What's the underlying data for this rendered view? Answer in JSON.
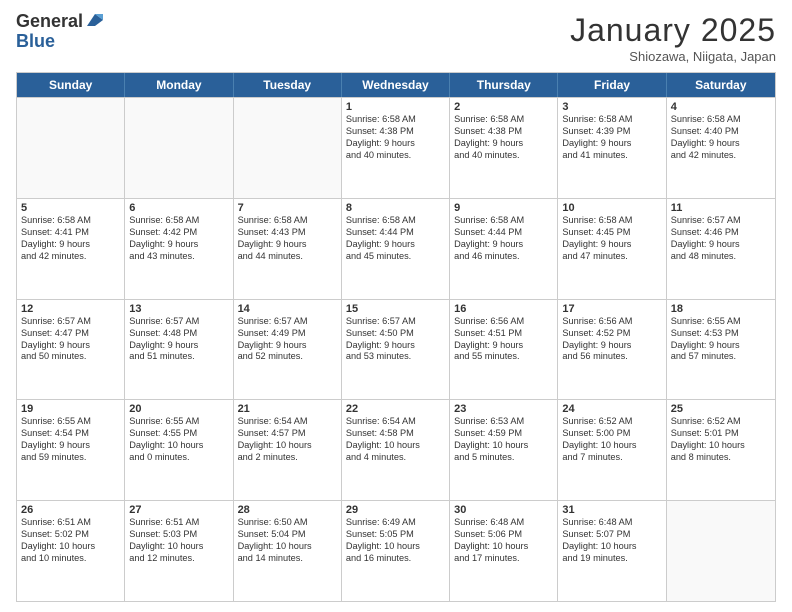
{
  "logo": {
    "general": "General",
    "blue": "Blue"
  },
  "title": "January 2025",
  "subtitle": "Shiozawa, Niigata, Japan",
  "days": [
    "Sunday",
    "Monday",
    "Tuesday",
    "Wednesday",
    "Thursday",
    "Friday",
    "Saturday"
  ],
  "rows": [
    [
      {
        "day": "",
        "lines": []
      },
      {
        "day": "",
        "lines": []
      },
      {
        "day": "",
        "lines": []
      },
      {
        "day": "1",
        "lines": [
          "Sunrise: 6:58 AM",
          "Sunset: 4:38 PM",
          "Daylight: 9 hours",
          "and 40 minutes."
        ]
      },
      {
        "day": "2",
        "lines": [
          "Sunrise: 6:58 AM",
          "Sunset: 4:38 PM",
          "Daylight: 9 hours",
          "and 40 minutes."
        ]
      },
      {
        "day": "3",
        "lines": [
          "Sunrise: 6:58 AM",
          "Sunset: 4:39 PM",
          "Daylight: 9 hours",
          "and 41 minutes."
        ]
      },
      {
        "day": "4",
        "lines": [
          "Sunrise: 6:58 AM",
          "Sunset: 4:40 PM",
          "Daylight: 9 hours",
          "and 42 minutes."
        ]
      }
    ],
    [
      {
        "day": "5",
        "lines": [
          "Sunrise: 6:58 AM",
          "Sunset: 4:41 PM",
          "Daylight: 9 hours",
          "and 42 minutes."
        ]
      },
      {
        "day": "6",
        "lines": [
          "Sunrise: 6:58 AM",
          "Sunset: 4:42 PM",
          "Daylight: 9 hours",
          "and 43 minutes."
        ]
      },
      {
        "day": "7",
        "lines": [
          "Sunrise: 6:58 AM",
          "Sunset: 4:43 PM",
          "Daylight: 9 hours",
          "and 44 minutes."
        ]
      },
      {
        "day": "8",
        "lines": [
          "Sunrise: 6:58 AM",
          "Sunset: 4:44 PM",
          "Daylight: 9 hours",
          "and 45 minutes."
        ]
      },
      {
        "day": "9",
        "lines": [
          "Sunrise: 6:58 AM",
          "Sunset: 4:44 PM",
          "Daylight: 9 hours",
          "and 46 minutes."
        ]
      },
      {
        "day": "10",
        "lines": [
          "Sunrise: 6:58 AM",
          "Sunset: 4:45 PM",
          "Daylight: 9 hours",
          "and 47 minutes."
        ]
      },
      {
        "day": "11",
        "lines": [
          "Sunrise: 6:57 AM",
          "Sunset: 4:46 PM",
          "Daylight: 9 hours",
          "and 48 minutes."
        ]
      }
    ],
    [
      {
        "day": "12",
        "lines": [
          "Sunrise: 6:57 AM",
          "Sunset: 4:47 PM",
          "Daylight: 9 hours",
          "and 50 minutes."
        ]
      },
      {
        "day": "13",
        "lines": [
          "Sunrise: 6:57 AM",
          "Sunset: 4:48 PM",
          "Daylight: 9 hours",
          "and 51 minutes."
        ]
      },
      {
        "day": "14",
        "lines": [
          "Sunrise: 6:57 AM",
          "Sunset: 4:49 PM",
          "Daylight: 9 hours",
          "and 52 minutes."
        ]
      },
      {
        "day": "15",
        "lines": [
          "Sunrise: 6:57 AM",
          "Sunset: 4:50 PM",
          "Daylight: 9 hours",
          "and 53 minutes."
        ]
      },
      {
        "day": "16",
        "lines": [
          "Sunrise: 6:56 AM",
          "Sunset: 4:51 PM",
          "Daylight: 9 hours",
          "and 55 minutes."
        ]
      },
      {
        "day": "17",
        "lines": [
          "Sunrise: 6:56 AM",
          "Sunset: 4:52 PM",
          "Daylight: 9 hours",
          "and 56 minutes."
        ]
      },
      {
        "day": "18",
        "lines": [
          "Sunrise: 6:55 AM",
          "Sunset: 4:53 PM",
          "Daylight: 9 hours",
          "and 57 minutes."
        ]
      }
    ],
    [
      {
        "day": "19",
        "lines": [
          "Sunrise: 6:55 AM",
          "Sunset: 4:54 PM",
          "Daylight: 9 hours",
          "and 59 minutes."
        ]
      },
      {
        "day": "20",
        "lines": [
          "Sunrise: 6:55 AM",
          "Sunset: 4:55 PM",
          "Daylight: 10 hours",
          "and 0 minutes."
        ]
      },
      {
        "day": "21",
        "lines": [
          "Sunrise: 6:54 AM",
          "Sunset: 4:57 PM",
          "Daylight: 10 hours",
          "and 2 minutes."
        ]
      },
      {
        "day": "22",
        "lines": [
          "Sunrise: 6:54 AM",
          "Sunset: 4:58 PM",
          "Daylight: 10 hours",
          "and 4 minutes."
        ]
      },
      {
        "day": "23",
        "lines": [
          "Sunrise: 6:53 AM",
          "Sunset: 4:59 PM",
          "Daylight: 10 hours",
          "and 5 minutes."
        ]
      },
      {
        "day": "24",
        "lines": [
          "Sunrise: 6:52 AM",
          "Sunset: 5:00 PM",
          "Daylight: 10 hours",
          "and 7 minutes."
        ]
      },
      {
        "day": "25",
        "lines": [
          "Sunrise: 6:52 AM",
          "Sunset: 5:01 PM",
          "Daylight: 10 hours",
          "and 8 minutes."
        ]
      }
    ],
    [
      {
        "day": "26",
        "lines": [
          "Sunrise: 6:51 AM",
          "Sunset: 5:02 PM",
          "Daylight: 10 hours",
          "and 10 minutes."
        ]
      },
      {
        "day": "27",
        "lines": [
          "Sunrise: 6:51 AM",
          "Sunset: 5:03 PM",
          "Daylight: 10 hours",
          "and 12 minutes."
        ]
      },
      {
        "day": "28",
        "lines": [
          "Sunrise: 6:50 AM",
          "Sunset: 5:04 PM",
          "Daylight: 10 hours",
          "and 14 minutes."
        ]
      },
      {
        "day": "29",
        "lines": [
          "Sunrise: 6:49 AM",
          "Sunset: 5:05 PM",
          "Daylight: 10 hours",
          "and 16 minutes."
        ]
      },
      {
        "day": "30",
        "lines": [
          "Sunrise: 6:48 AM",
          "Sunset: 5:06 PM",
          "Daylight: 10 hours",
          "and 17 minutes."
        ]
      },
      {
        "day": "31",
        "lines": [
          "Sunrise: 6:48 AM",
          "Sunset: 5:07 PM",
          "Daylight: 10 hours",
          "and 19 minutes."
        ]
      },
      {
        "day": "",
        "lines": []
      }
    ]
  ]
}
